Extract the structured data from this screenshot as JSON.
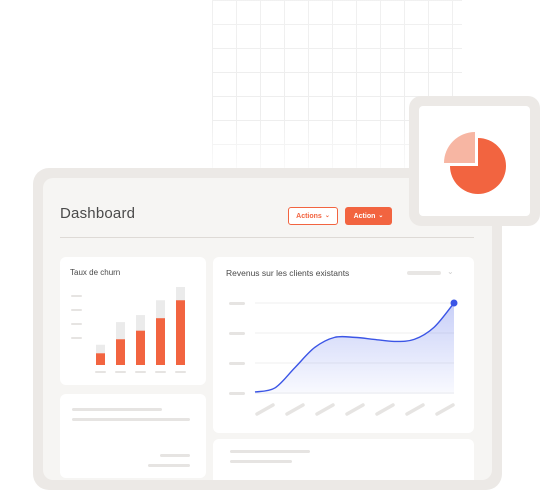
{
  "dashboard": {
    "title": "Dashboard",
    "actions_outline_label": "Actions",
    "action_solid_label": "Action"
  },
  "churn_card": {
    "title": "Taux de churn"
  },
  "revenue_card": {
    "title": "Revenus sur les clients existants"
  },
  "icons": {
    "chevron": "chevron-down-icon",
    "pie": "pie-chart-icon"
  },
  "colors": {
    "accent": "#f26440",
    "accent_light": "#f7b6a3",
    "bar_back": "#ebebeb",
    "line": "#3b55e6"
  },
  "chart_data": [
    {
      "type": "bar",
      "title": "Taux de churn",
      "categories": [
        "",
        "",
        "",
        "",
        ""
      ],
      "series": [
        {
          "values": [
            1.5,
            3.3,
            4.4,
            6.0,
            8.3
          ]
        },
        {
          "values": [
            2.6,
            5.5,
            6.4,
            8.3,
            10.0
          ]
        }
      ],
      "ylim": [
        0,
        10
      ]
    },
    {
      "type": "area",
      "title": "Revenus sur les clients existants",
      "x": [
        0,
        1,
        2,
        3,
        4,
        5,
        6,
        7,
        8,
        9,
        10
      ],
      "values": [
        0.1,
        0.3,
        1.3,
        2.3,
        2.8,
        2.8,
        2.7,
        2.6,
        2.7,
        3.3,
        4.5
      ],
      "ylim": [
        0,
        4.5
      ]
    }
  ]
}
